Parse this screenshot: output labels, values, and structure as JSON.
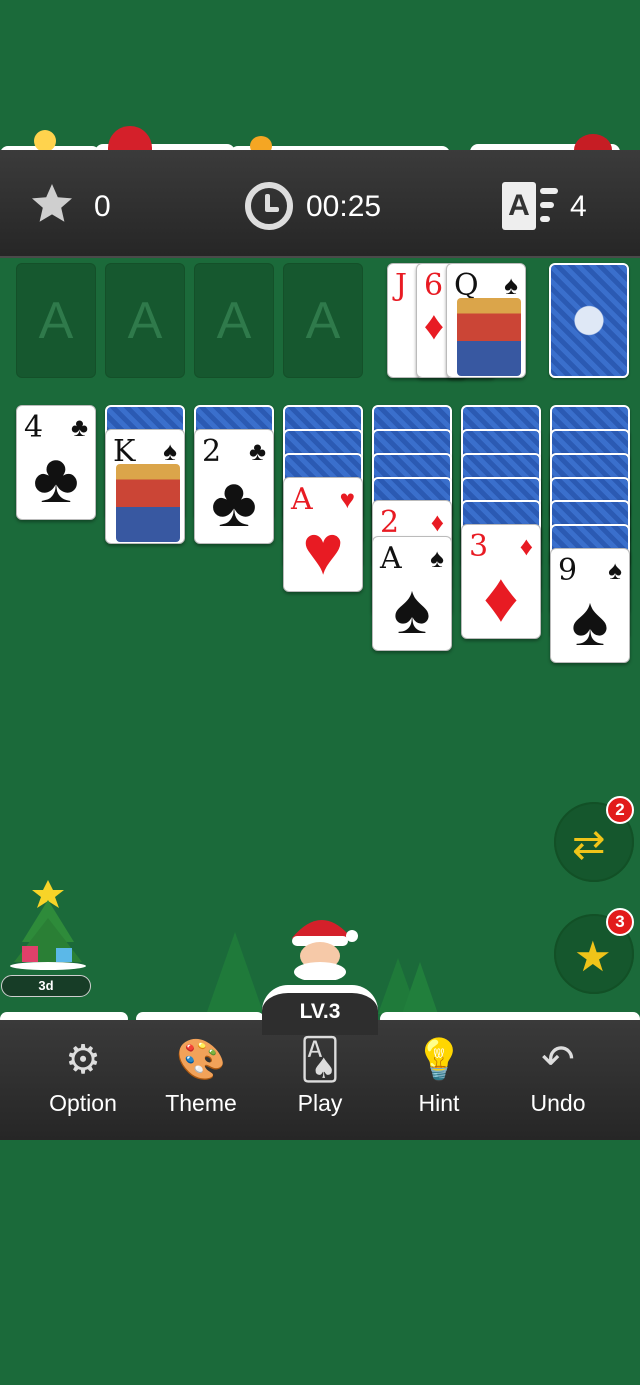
{
  "header": {
    "score": "0",
    "time": "00:25",
    "moves": "4"
  },
  "foundations": [
    "A",
    "A",
    "A",
    "A"
  ],
  "waste": [
    {
      "rank": "J",
      "suit": "♦",
      "color": "red"
    },
    {
      "rank": "6",
      "suit": "♦",
      "color": "red"
    },
    {
      "rank": "Q",
      "suit": "♠",
      "color": "black"
    }
  ],
  "tableau": [
    {
      "rank": "4",
      "suit": "♣",
      "color": "black"
    },
    {
      "rank": "K",
      "suit": "♠",
      "color": "black"
    },
    {
      "rank": "2",
      "suit": "♣",
      "color": "black"
    },
    {
      "rank": "A",
      "suit": "♥",
      "color": "red"
    },
    {
      "rank": "2",
      "suit": "♦",
      "color": "red"
    },
    {
      "rank": "A",
      "suit": "♠",
      "color": "black"
    },
    {
      "rank": "3",
      "suit": "♦",
      "color": "red"
    },
    {
      "rank": "9",
      "suit": "♠",
      "color": "black"
    }
  ],
  "powerups": {
    "shuffle_count": "2",
    "magic_count": "3"
  },
  "event": {
    "days_left": "3d"
  },
  "level": "LV.3",
  "toolbar": {
    "option": "Option",
    "theme": "Theme",
    "play": "Play",
    "hint": "Hint",
    "undo": "Undo"
  },
  "icons": [
    "star-icon",
    "clock-icon",
    "auto-finish-icon",
    "shuffle-icon",
    "magic-wand-icon",
    "gear-icon",
    "palette-icon",
    "cards-icon",
    "lightbulb-icon",
    "undo-arrow-icon"
  ],
  "colors": {
    "felt": "#1b6a3a",
    "bar": "#2e2e2e",
    "badge": "#e21b1b",
    "accent": "#f0c419"
  }
}
